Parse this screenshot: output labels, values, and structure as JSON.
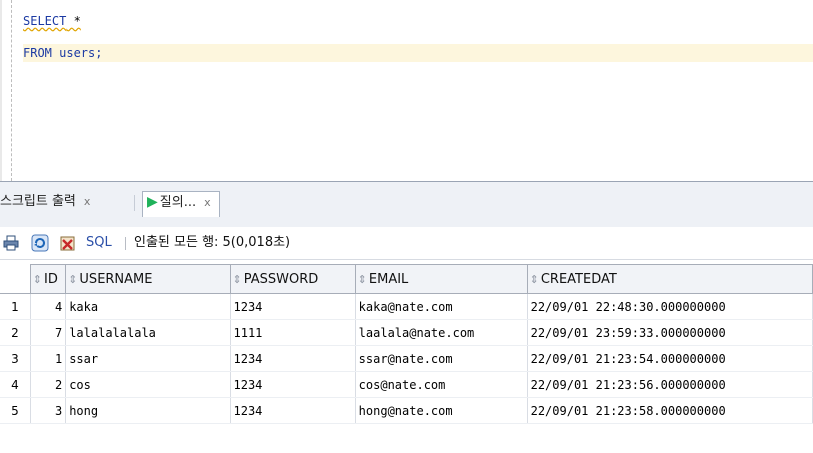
{
  "editor": {
    "line1_kw": "SELECT",
    "line1_rest": " *",
    "line2_kw": "FROM",
    "line2_rest": " users;"
  },
  "tabs": [
    {
      "label": "스크립트 출력",
      "close": "x"
    },
    {
      "label": "질의...",
      "close": "x"
    }
  ],
  "toolbar": {
    "sql_label": "SQL",
    "status": "인출된 모든 행: 5(0,018초)"
  },
  "grid": {
    "columns": [
      "ID",
      "USERNAME",
      "PASSWORD",
      "EMAIL",
      "CREATEDAT"
    ],
    "rows": [
      {
        "rownum": "1",
        "id": "4",
        "username": "kaka",
        "password": "1234",
        "email": "kaka@nate.com",
        "createdat": "22/09/01 22:48:30.000000000"
      },
      {
        "rownum": "2",
        "id": "7",
        "username": "lalalalalala",
        "password": "1111",
        "email": "laalala@nate.com",
        "createdat": "22/09/01 23:59:33.000000000"
      },
      {
        "rownum": "3",
        "id": "1",
        "username": "ssar",
        "password": "1234",
        "email": "ssar@nate.com",
        "createdat": "22/09/01 21:23:54.000000000"
      },
      {
        "rownum": "4",
        "id": "2",
        "username": "cos",
        "password": "1234",
        "email": "cos@nate.com",
        "createdat": "22/09/01 21:23:56.000000000"
      },
      {
        "rownum": "5",
        "id": "3",
        "username": "hong",
        "password": "1234",
        "email": "hong@nate.com",
        "createdat": "22/09/01 21:23:58.000000000"
      }
    ]
  },
  "icons": {
    "print": "print-icon",
    "refresh": "refresh-icon",
    "export": "export-icon",
    "run": "run-icon",
    "sort": "sort-icon"
  },
  "colors": {
    "keyword": "#1c3aa3",
    "current_line": "#fdf6dd",
    "run_green": "#1fb25a"
  }
}
